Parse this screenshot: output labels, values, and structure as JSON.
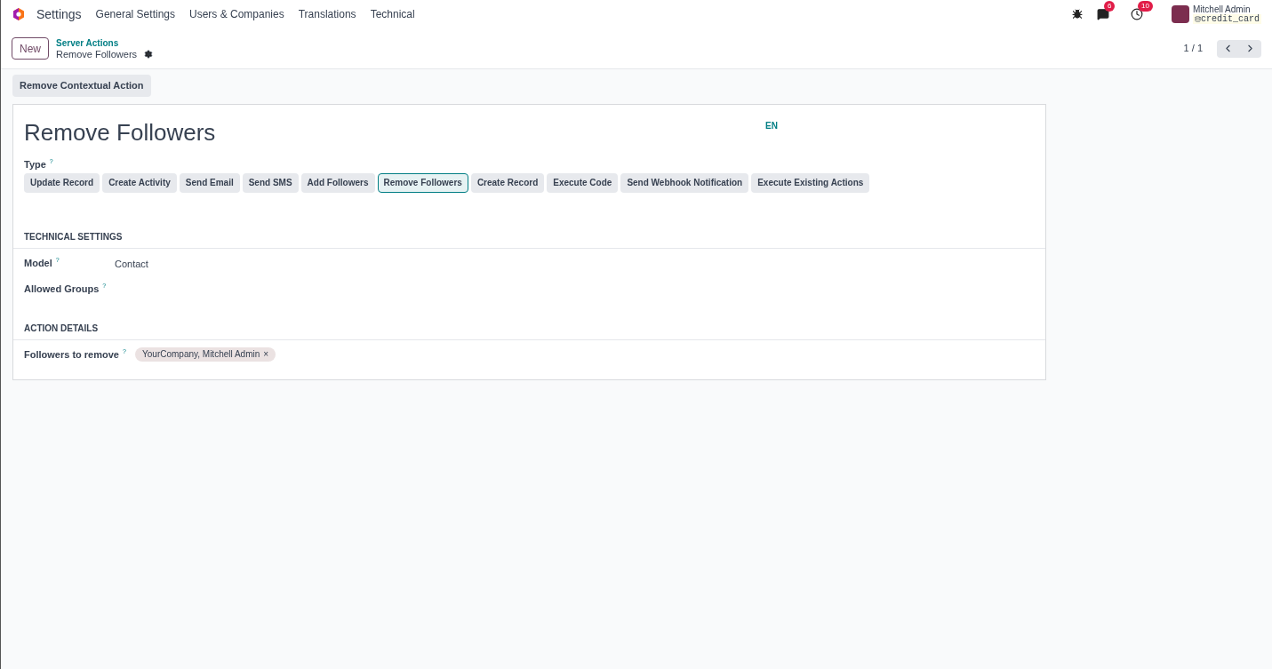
{
  "navbar": {
    "app_name": "Settings",
    "menu": [
      "General Settings",
      "Users & Companies",
      "Translations",
      "Technical"
    ],
    "messages_count": "6",
    "activities_count": "10",
    "user_name": "Mitchell Admin",
    "database": "credit_card"
  },
  "control_panel": {
    "new_button": "New",
    "breadcrumb": "Server Actions",
    "title": "Remove Followers",
    "pager": "1 / 1"
  },
  "action_buttons": [
    "Remove Contextual Action"
  ],
  "form": {
    "name": "Remove Followers",
    "language": "EN",
    "type_label": "Type",
    "type_help": "?",
    "types": [
      {
        "label": "Update Record",
        "selected": false
      },
      {
        "label": "Create Activity",
        "selected": false
      },
      {
        "label": "Send Email",
        "selected": false
      },
      {
        "label": "Send SMS",
        "selected": false
      },
      {
        "label": "Add Followers",
        "selected": false
      },
      {
        "label": "Remove Followers",
        "selected": true
      },
      {
        "label": "Create Record",
        "selected": false
      },
      {
        "label": "Execute Code",
        "selected": false
      },
      {
        "label": "Send Webhook Notification",
        "selected": false
      },
      {
        "label": "Execute Existing Actions",
        "selected": false
      }
    ],
    "sections": [
      {
        "title": "TECHNICAL SETTINGS",
        "fields": [
          {
            "label": "Model",
            "help": "?",
            "value": "Contact"
          },
          {
            "label": "Allowed Groups",
            "help": "?"
          }
        ]
      },
      {
        "title": "ACTION DETAILS",
        "fields": [
          {
            "label": "Followers to remove",
            "help": "?",
            "tags": [
              {
                "label": "YourCompany, Mitchell Admin",
                "remove": "×"
              }
            ]
          }
        ]
      }
    ]
  }
}
